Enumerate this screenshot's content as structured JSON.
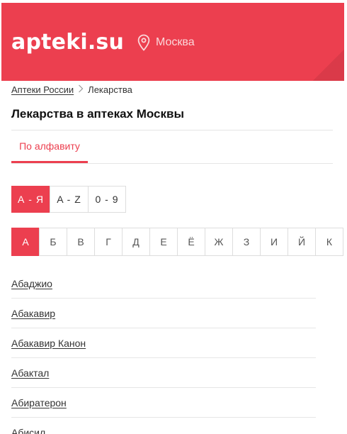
{
  "header": {
    "logo": "apteki.su",
    "city": "Москва",
    "brand_color": "#ec3f4f"
  },
  "breadcrumb": {
    "items": [
      "Аптеки России",
      "Лекарства"
    ]
  },
  "title": "Лекарства в аптеках Москвы",
  "tabs": [
    {
      "label": "По алфавиту",
      "active": true
    }
  ],
  "alphabet_switch": [
    {
      "label": "А - Я",
      "active": true
    },
    {
      "label": "A - Z",
      "active": false
    },
    {
      "label": "0 - 9",
      "active": false
    }
  ],
  "letters": [
    {
      "label": "А",
      "active": true
    },
    {
      "label": "Б",
      "active": false
    },
    {
      "label": "В",
      "active": false
    },
    {
      "label": "Г",
      "active": false
    },
    {
      "label": "Д",
      "active": false
    },
    {
      "label": "Е",
      "active": false
    },
    {
      "label": "Ё",
      "active": false
    },
    {
      "label": "Ж",
      "active": false
    },
    {
      "label": "З",
      "active": false
    },
    {
      "label": "И",
      "active": false
    },
    {
      "label": "Й",
      "active": false
    },
    {
      "label": "К",
      "active": false
    }
  ],
  "drugs": [
    "Абаджио",
    "Абакавир",
    "Абакавир Канон",
    "Абактал",
    "Абиратерон",
    "Абисил"
  ]
}
